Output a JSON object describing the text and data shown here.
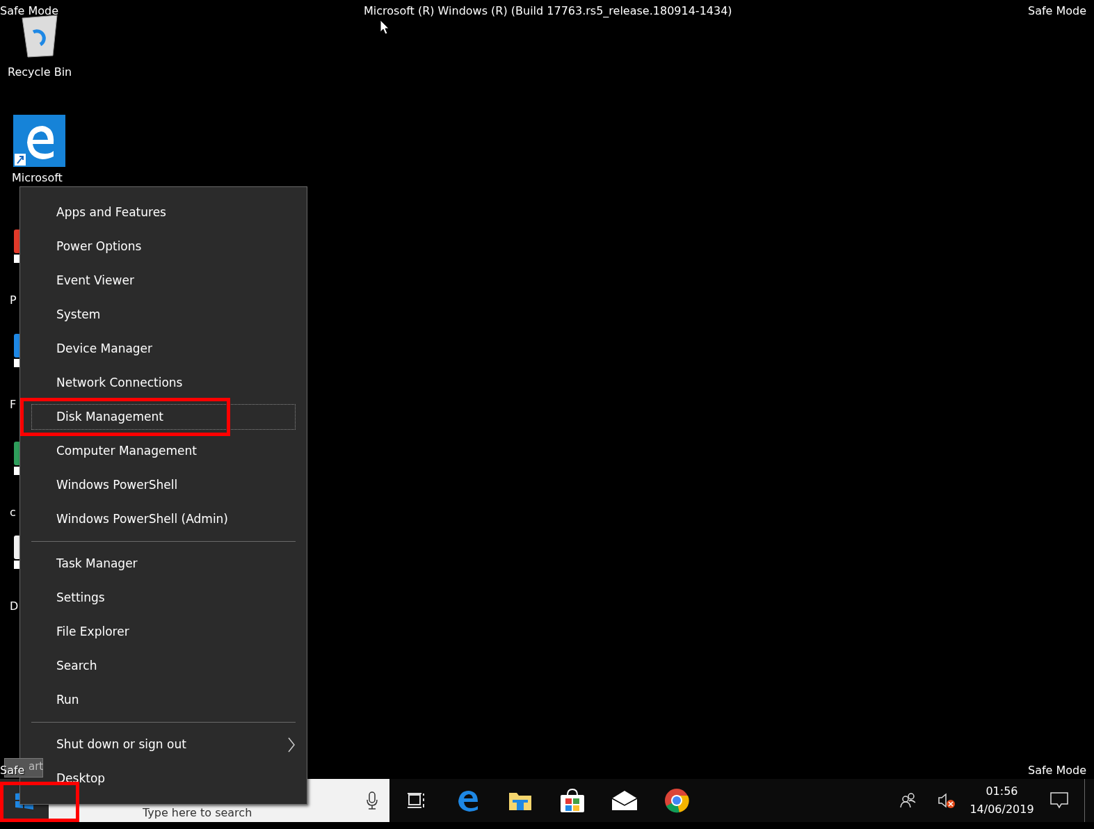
{
  "desktop": {
    "top_banner": "Microsoft (R) Windows (R) (Build 17763.rs5_release.180914-1434)",
    "corner_labels": [
      "Safe Mode",
      "Safe Mode",
      "Safe",
      "Safe Mode"
    ],
    "icons": [
      {
        "kind": "recycle",
        "label": "Recycle Bin"
      },
      {
        "kind": "edge",
        "label": "Microsoft"
      },
      {
        "kind": "partial",
        "label": "P",
        "color": "#e23a2a"
      },
      {
        "kind": "partial",
        "label": "F",
        "color": "#1e88e5"
      },
      {
        "kind": "partial",
        "label": "c",
        "color": "#2e9e5b"
      },
      {
        "kind": "partial",
        "label": "D",
        "color": "#f2f2f2"
      }
    ]
  },
  "tooltip": "art",
  "menu": {
    "groups": [
      [
        {
          "label": "Apps and Features",
          "selected": false,
          "annotated": false
        },
        {
          "label": "Power Options",
          "selected": false,
          "annotated": false
        },
        {
          "label": "Event Viewer",
          "selected": false,
          "annotated": false
        },
        {
          "label": "System",
          "selected": false,
          "annotated": false
        },
        {
          "label": "Device Manager",
          "selected": false,
          "annotated": false
        },
        {
          "label": "Network Connections",
          "selected": false,
          "annotated": false
        },
        {
          "label": "Disk Management",
          "selected": true,
          "annotated": true
        },
        {
          "label": "Computer Management",
          "selected": false,
          "annotated": false
        },
        {
          "label": "Windows PowerShell",
          "selected": false,
          "annotated": false
        },
        {
          "label": "Windows PowerShell (Admin)",
          "selected": false,
          "annotated": false
        }
      ],
      [
        {
          "label": "Task Manager",
          "selected": false,
          "annotated": false
        },
        {
          "label": "Settings",
          "selected": false,
          "annotated": false
        },
        {
          "label": "File Explorer",
          "selected": false,
          "annotated": false
        },
        {
          "label": "Search",
          "selected": false,
          "annotated": false
        },
        {
          "label": "Run",
          "selected": false,
          "annotated": false
        }
      ],
      [
        {
          "label": "Shut down or sign out",
          "selected": false,
          "annotated": false,
          "submenu": true
        },
        {
          "label": "Desktop",
          "selected": false,
          "annotated": false
        }
      ]
    ]
  },
  "taskbar": {
    "start_annotated": true,
    "search": {
      "placeholder": "Type here to search"
    },
    "apps": [
      {
        "kind": "taskview"
      },
      {
        "kind": "edge"
      },
      {
        "kind": "explorer"
      },
      {
        "kind": "store"
      },
      {
        "kind": "mail"
      },
      {
        "kind": "chrome"
      }
    ],
    "tray": {
      "time": "01:56",
      "date": "14/06/2019",
      "muted": true
    }
  }
}
